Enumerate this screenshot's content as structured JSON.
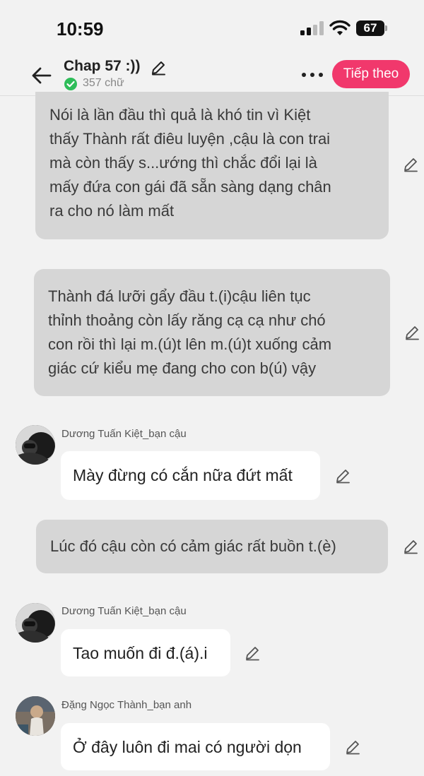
{
  "status_bar": {
    "time": "10:59",
    "battery": "67"
  },
  "header": {
    "title": "Chap 57 :))",
    "word_count": "357 chữ",
    "next_label": "Tiếp theo",
    "accent_color": "#f1386c"
  },
  "messages": [
    {
      "type": "narration",
      "lines": [
        "Nói là lần đầu thì quả là khó tin vì Kiệt",
        "thấy Thành rất điêu luyện ,cậu là con trai",
        "mà còn thấy s...ướng thì chắc đổi lại là",
        "mấy đứa con gái đã sẵn sàng dạng chân",
        "ra cho nó làm mất"
      ]
    },
    {
      "type": "narration",
      "lines": [
        "Thành đá lưỡi gẩy đầu t.(i)cậu liên tục",
        "thỉnh thoảng còn lấy răng cạ cạ như chó",
        "con rồi thì lại m.(ú)t lên m.(ú)t xuống cảm",
        "giác cứ kiểu mẹ đang cho con b(ú) vậy"
      ]
    },
    {
      "type": "speech",
      "character": "Dương Tuấn Kiệt_bạn cậu",
      "text": "Mày đừng có cắn nữa đứt mất"
    },
    {
      "type": "narration",
      "lines": [
        "Lúc đó cậu còn có cảm giác rất buồn t.(è)"
      ]
    },
    {
      "type": "speech",
      "character": "Dương Tuấn Kiệt_bạn cậu",
      "text": "Tao muốn đi đ.(á).i"
    },
    {
      "type": "speech",
      "character": "Đặng Ngọc Thành_bạn anh",
      "text": "Ở đây luôn đi mai có người dọn"
    }
  ]
}
